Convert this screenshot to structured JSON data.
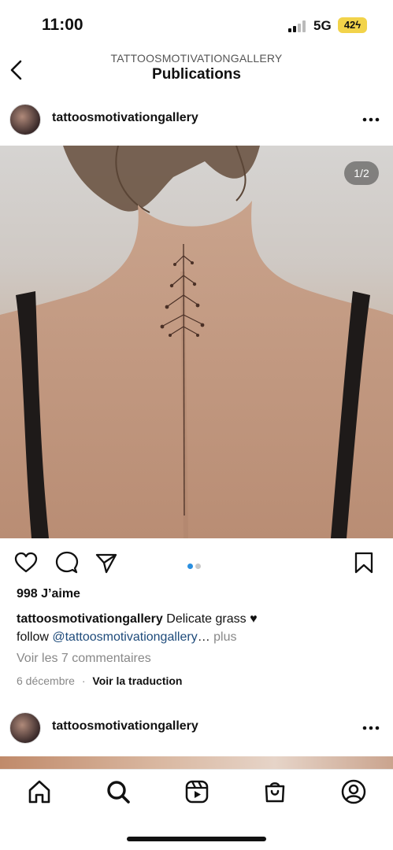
{
  "status_bar": {
    "time": "11:00",
    "network": "5G",
    "battery": "42"
  },
  "header": {
    "account": "TATTOOSMOTIVATIONGALLERY",
    "title": "Publications"
  },
  "post": {
    "username": "tattoosmotivationgallery",
    "image_counter": "1/2",
    "carousel_active_index": 0,
    "carousel_count": 2,
    "likes": "998 J’aime",
    "caption_username": "tattoosmotivationgallery",
    "caption_text": " Delicate grass ♥",
    "caption_follow": "follow ",
    "caption_mention": "@tattoosmotivationgallery",
    "caption_ellipsis": "… ",
    "caption_more": "plus",
    "comments_link": "Voir les 7 commentaires",
    "date": "6 décembre",
    "separator": "·",
    "translate_link": "Voir la traduction"
  },
  "next_post": {
    "username": "tattoosmotivationgallery"
  },
  "colors": {
    "accent_blue": "#2a8fe0",
    "mention": "#1d4a7a",
    "secondary_text": "#888888",
    "battery_yellow": "#f2d34a"
  },
  "icons": {
    "header": [
      "back-icon"
    ],
    "post": [
      "more-icon",
      "like-icon",
      "comment-icon",
      "share-icon",
      "save-icon"
    ],
    "nav": [
      "home-icon",
      "search-icon",
      "reels-icon",
      "shop-icon",
      "profile-icon"
    ]
  }
}
